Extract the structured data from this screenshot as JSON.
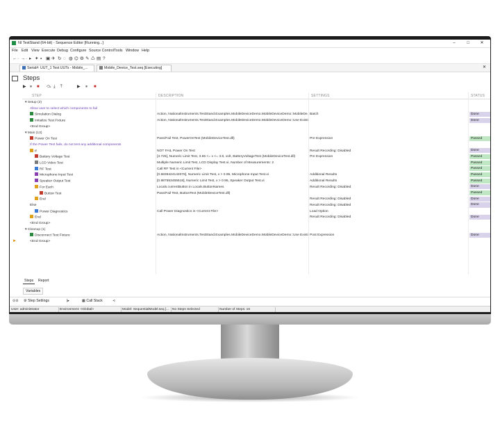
{
  "window": {
    "title": "NI TestStand (64-bit) - Sequence Editor [Running...]",
    "minimize": "–",
    "maximize": "□",
    "close": "✕"
  },
  "menu": [
    "File",
    "Edit",
    "View",
    "Execute",
    "Debug",
    "Configure",
    "Source Control",
    "Tools",
    "Window",
    "Help"
  ],
  "toolbar_icons": [
    "←",
    "·",
    "→",
    "·",
    "▸",
    "✦",
    "▪",
    "▣",
    "✈",
    "↻",
    "◌",
    "◍",
    "⌬",
    "⚙",
    "✎",
    "♺",
    "▤",
    "?"
  ],
  "tabs": {
    "active": "Serial#: UUT_1  Test UUTs - Mobile_...",
    "file": "Mobile_Device_Test.seq [Executing]",
    "close": "✕"
  },
  "panel": {
    "title": "Steps"
  },
  "exec_toolbar": [
    "▶",
    "⏸",
    "■",
    "⤼",
    "⤓",
    "⤒",
    "▶",
    "⏸",
    "■"
  ],
  "columns": {
    "step": "STEP",
    "description": "DESCRIPTION",
    "settings": "SETTINGS",
    "status": "STATUS"
  },
  "rows": [
    {
      "step": "Setup (2)",
      "indent": 0,
      "type": "group",
      "desc": "",
      "settings": "",
      "status": ""
    },
    {
      "step": "Allow user to select which components to fail",
      "indent": 1,
      "type": "comment",
      "desc": "",
      "settings": "",
      "status": ""
    },
    {
      "step": "Simulation Dialog",
      "indent": 1,
      "icon": "n",
      "desc": "Action,  NationalInstruments.TestStand.Examples.MobileDeviceDemo.MobileDeviceDemo::MobileDe...",
      "settings": "Batch",
      "status": "Done"
    },
    {
      "step": "Initialize Test Fixture",
      "indent": 1,
      "icon": "n",
      "desc": "Action,  NationalInstruments.TestStand.Examples.MobileDeviceDemo.MobileDeviceDemo::Use Existi...",
      "settings": "",
      "status": "Done"
    },
    {
      "step": "<End Group>",
      "indent": 1,
      "type": "plain",
      "desc": "",
      "settings": "",
      "status": ""
    },
    {
      "step": "Main (13)",
      "indent": 0,
      "type": "group",
      "desc": "",
      "settings": "",
      "status": ""
    },
    {
      "step": "Power On Test",
      "indent": 1,
      "icon": "c",
      "desc": "Pass/Fail Test,  PowerOnTest (MobileDeviceTest.dll)",
      "settings": "Pre Expression",
      "status": "Passed"
    },
    {
      "step": "If the Power Test fails, do not test any additional components",
      "indent": 1,
      "type": "comment",
      "desc": "",
      "settings": "",
      "status": ""
    },
    {
      "step": "If",
      "indent": 1,
      "icon": "y",
      "desc": "NOT FAIL Power On Test",
      "settings": "Result Recording: Disabled",
      "status": "Done"
    },
    {
      "step": "Battery Voltage Test",
      "indent": 2,
      "icon": "c",
      "desc": "[3.725], Numeric Limit Test,  3.65 <= x <= 3.8, volt, BatteryVoltageTest (MobileDeviceTest.dll)",
      "settings": "Pre Expression",
      "status": "Passed"
    },
    {
      "step": "LCD Video Test",
      "indent": 2,
      "icon": "g",
      "desc": "Multiple Numeric Limit Test,  LCD Display Test.vi, Number of Measurements: 2",
      "settings": "",
      "status": "Passed"
    },
    {
      "step": "RF Test",
      "indent": 2,
      "icon": "b",
      "desc": "Call RF Test in <Current File>",
      "settings": "",
      "status": "Passed"
    },
    {
      "step": "Microphone Input Test",
      "indent": 2,
      "icon": "p",
      "desc": "[0.5839424142076], Numeric Limit Test,  x > 0.95, Microphone Input Test.vi",
      "settings": "Additional Results",
      "status": "Passed"
    },
    {
      "step": "Speaker Output Test",
      "indent": 2,
      "icon": "p",
      "desc": "[0.987553455518], Numeric Limit Test,  x > 0.95, Speaker Output Test.vi",
      "settings": "Additional Results",
      "status": "Passed"
    },
    {
      "step": "For Each",
      "indent": 2,
      "icon": "y",
      "desc": "Locals.currentButton in Locals.ButtonNames",
      "settings": "Result Recording: Disabled",
      "status": "Done"
    },
    {
      "step": "Button Test",
      "indent": 3,
      "icon": "c",
      "desc": "Pass/Fail Test,  ButtonTest (MobileDeviceTest.dll)",
      "settings": "",
      "status": "Passed"
    },
    {
      "step": "End",
      "indent": 2,
      "icon": "y",
      "desc": "",
      "settings": "Result Recording: Disabled",
      "status": "Done"
    },
    {
      "step": "Else",
      "indent": 1,
      "type": "plain",
      "desc": "",
      "settings": "Result Recording: Disabled",
      "status": "Done"
    },
    {
      "step": "Power Diagnostics",
      "indent": 2,
      "icon": "b",
      "desc": "Call Power Diagnostics in <Current File>",
      "settings": "Load Option",
      "status": ""
    },
    {
      "step": "End",
      "indent": 1,
      "icon": "y",
      "desc": "",
      "settings": "Result Recording: Disabled",
      "status": "Done"
    },
    {
      "step": "<End Group>",
      "indent": 1,
      "type": "plain",
      "desc": "",
      "settings": "",
      "status": ""
    },
    {
      "step": "Cleanup (1)",
      "indent": 0,
      "type": "group",
      "desc": "",
      "settings": "",
      "status": ""
    },
    {
      "step": "Disconnect Test Fixture",
      "indent": 1,
      "icon": "n",
      "desc": "Action,  NationalInstruments.TestStand.Examples.MobileDeviceDemo.MobileDeviceDemo::Use Existi...",
      "settings": "Post Expression",
      "status": "Done"
    },
    {
      "step": "<End Group>",
      "indent": 1,
      "type": "plain",
      "desc": "",
      "settings": "",
      "status": "",
      "pointer": true
    }
  ],
  "bottom_tabs": [
    "Steps",
    "Report"
  ],
  "variables_tab": "Variables",
  "toolstrip": [
    "Step Settings",
    "Call Stack"
  ],
  "status_bar": {
    "user": "User: administrator",
    "environment": "Environment: <Global>",
    "model": "Model: SequentialModel.seq [...",
    "selection": "No Steps Selected",
    "count": "Number of Steps: 16"
  }
}
